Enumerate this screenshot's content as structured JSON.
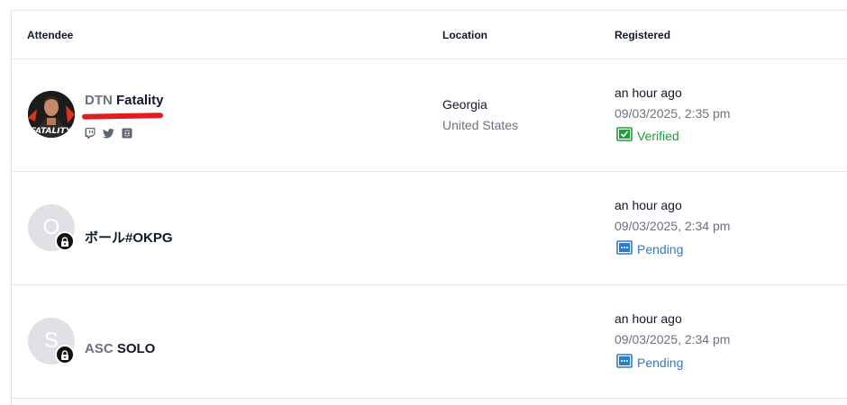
{
  "columns": {
    "attendee": "Attendee",
    "location": "Location",
    "registered": "Registered"
  },
  "rows": [
    {
      "team": "DTN",
      "player": "Fatality",
      "avatar_letter": "",
      "avatar_icon": "fatality-photo",
      "socials": [
        "twitch-icon",
        "twitter-icon",
        "discord-icon"
      ],
      "location_region": "Georgia",
      "location_country": "United States",
      "registered_relative": "an hour ago",
      "registered_date": "09/03/2025, 2:35 pm",
      "status": "Verified"
    },
    {
      "team": "",
      "player": "ボール#OKPG",
      "avatar_letter": "O",
      "avatar_icon": "lock-icon",
      "registered_relative": "an hour ago",
      "registered_date": "09/03/2025, 2:34 pm",
      "status": "Pending"
    },
    {
      "team": "ASC",
      "player": "SOLO",
      "avatar_letter": "S",
      "avatar_icon": "lock-icon",
      "registered_relative": "an hour ago",
      "registered_date": "09/03/2025, 2:34 pm",
      "status": "Pending"
    }
  ],
  "colors": {
    "verified": "#1f9d3a",
    "pending": "#2f7bc4",
    "border": "#e1e3e6",
    "redaction": "#e11d1d"
  }
}
